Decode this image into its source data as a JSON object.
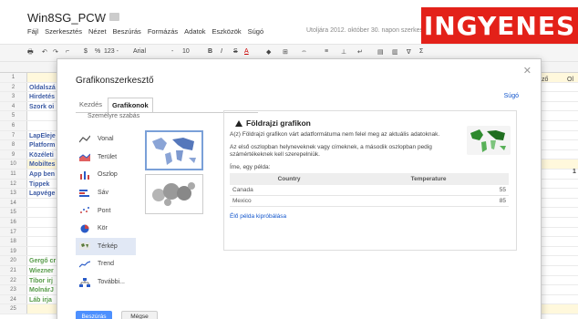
{
  "header": {
    "title": "Win8SG_PCW",
    "menu": [
      "Fájl",
      "Szerkesztés",
      "Nézet",
      "Beszúrás",
      "Formázás",
      "Adatok",
      "Eszközök",
      "Súgó"
    ],
    "last_edit": "Utoljára 2012. október 30. napon szerkesztették",
    "badge": "INGYENES"
  },
  "toolbar": {
    "items": [
      "$",
      "%",
      "123 -",
      "Arial",
      "-",
      "10",
      "B",
      "I",
      "S",
      "A",
      "Σ"
    ]
  },
  "grid": {
    "rows": [
      {
        "n": "1",
        "text": "",
        "color": "#222",
        "hl": true
      },
      {
        "n": "2",
        "text": "Oldalszá",
        "color": "#1c3f95"
      },
      {
        "n": "3",
        "text": "Hirdetés",
        "color": "#1c3f95"
      },
      {
        "n": "4",
        "text": "Szork oi",
        "color": "#1c3f95"
      },
      {
        "n": "5",
        "text": "",
        "color": "#222"
      },
      {
        "n": "6",
        "text": "",
        "color": "#222"
      },
      {
        "n": "7",
        "text": "LapEleje",
        "color": "#1c3f95"
      },
      {
        "n": "8",
        "text": "Platform",
        "color": "#1c3f95"
      },
      {
        "n": "9",
        "text": "Közéleti",
        "color": "#1c3f95"
      },
      {
        "n": "10",
        "text": "Mobiltes",
        "color": "#1c3f95",
        "hl": true
      },
      {
        "n": "11",
        "text": "App ben",
        "color": "#1c3f95"
      },
      {
        "n": "12",
        "text": "Tippek",
        "color": "#1c3f95"
      },
      {
        "n": "13",
        "text": "Lapvége",
        "color": "#1c3f95"
      },
      {
        "n": "14",
        "text": "",
        "color": "#222"
      },
      {
        "n": "15",
        "text": "",
        "color": "#222"
      },
      {
        "n": "16",
        "text": "",
        "color": "#222"
      },
      {
        "n": "17",
        "text": "",
        "color": "#222"
      },
      {
        "n": "18",
        "text": "",
        "color": "#222"
      },
      {
        "n": "19",
        "text": "",
        "color": "#222"
      },
      {
        "n": "20",
        "text": "Gergő cr",
        "color": "#3a8a2a"
      },
      {
        "n": "21",
        "text": "Wiezner",
        "color": "#3a8a2a"
      },
      {
        "n": "22",
        "text": "Tibor irj",
        "color": "#3a8a2a"
      },
      {
        "n": "23",
        "text": "MolnárJ",
        "color": "#3a8a2a"
      },
      {
        "n": "24",
        "text": "Láb irja",
        "color": "#3a8a2a"
      },
      {
        "n": "25",
        "text": "",
        "color": "#222",
        "hl": true
      }
    ],
    "right_col_a": "ző",
    "right_col_b": "Ol",
    "right_one": "1"
  },
  "dialog": {
    "title": "Grafikonszerkesztő",
    "help": "Súgó",
    "tabs": [
      "Kezdés",
      "Grafikonok"
    ],
    "active_tab": 1,
    "custom_label": "Személyre szabás",
    "types": [
      {
        "label": "Vonal",
        "icon": "line-chart-icon"
      },
      {
        "label": "Terület",
        "icon": "area-chart-icon"
      },
      {
        "label": "Oszlop",
        "icon": "column-chart-icon"
      },
      {
        "label": "Sáv",
        "icon": "bar-chart-icon"
      },
      {
        "label": "Pont",
        "icon": "scatter-chart-icon"
      },
      {
        "label": "Kör",
        "icon": "pie-chart-icon"
      },
      {
        "label": "Térkép",
        "icon": "map-chart-icon"
      },
      {
        "label": "Trend",
        "icon": "trend-chart-icon"
      },
      {
        "label": "További...",
        "icon": "more-charts-icon"
      }
    ],
    "active_type": 6,
    "detail": {
      "title": "Földrajzi grafikon",
      "p1": "A(z) Földrajzi grafikon várt adatformátuma nem felel meg az aktuális adatoknak.",
      "p2": "Az első oszlopban helyneveknek vagy címeknek, a második oszlopban pedig számértékeknek kell szerepelniük.",
      "p3": "Íme, egy példa:",
      "table": {
        "headers": [
          "Country",
          "Temperature"
        ],
        "rows": [
          [
            "Canada",
            "55"
          ],
          [
            "Mexico",
            "85"
          ]
        ]
      },
      "link": "Élő példa kipróbálása"
    },
    "insert": "Beszúrás",
    "cancel": "Mégse"
  }
}
